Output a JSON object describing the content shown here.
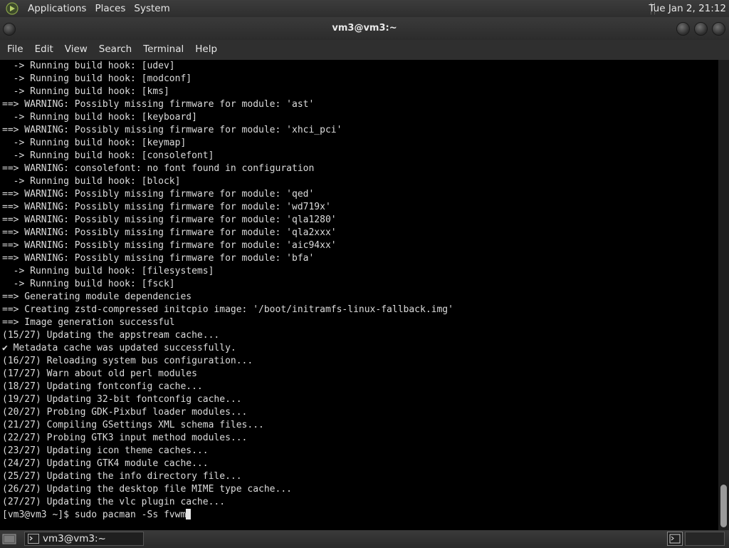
{
  "top_panel": {
    "menus": [
      "Applications",
      "Places",
      "System"
    ],
    "clock": "Tue Jan  2, 21:12",
    "logo_icon": "arch-linux-logo"
  },
  "window": {
    "title": "vm3@vm3:~",
    "menu": [
      "File",
      "Edit",
      "View",
      "Search",
      "Terminal",
      "Help"
    ]
  },
  "terminal": {
    "lines": [
      "  -> Running build hook: [udev]",
      "  -> Running build hook: [modconf]",
      "  -> Running build hook: [kms]",
      "==> WARNING: Possibly missing firmware for module: 'ast'",
      "  -> Running build hook: [keyboard]",
      "==> WARNING: Possibly missing firmware for module: 'xhci_pci'",
      "  -> Running build hook: [keymap]",
      "  -> Running build hook: [consolefont]",
      "==> WARNING: consolefont: no font found in configuration",
      "  -> Running build hook: [block]",
      "==> WARNING: Possibly missing firmware for module: 'qed'",
      "==> WARNING: Possibly missing firmware for module: 'wd719x'",
      "==> WARNING: Possibly missing firmware for module: 'qla1280'",
      "==> WARNING: Possibly missing firmware for module: 'qla2xxx'",
      "==> WARNING: Possibly missing firmware for module: 'aic94xx'",
      "==> WARNING: Possibly missing firmware for module: 'bfa'",
      "  -> Running build hook: [filesystems]",
      "  -> Running build hook: [fsck]",
      "==> Generating module dependencies",
      "==> Creating zstd-compressed initcpio image: '/boot/initramfs-linux-fallback.img'",
      "==> Image generation successful",
      "(15/27) Updating the appstream cache...",
      "✔ Metadata cache was updated successfully.",
      "(16/27) Reloading system bus configuration...",
      "(17/27) Warn about old perl modules",
      "(18/27) Updating fontconfig cache...",
      "(19/27) Updating 32-bit fontconfig cache...",
      "(20/27) Probing GDK-Pixbuf loader modules...",
      "(21/27) Compiling GSettings XML schema files...",
      "(22/27) Probing GTK3 input method modules...",
      "(23/27) Updating icon theme caches...",
      "(24/27) Updating GTK4 module cache...",
      "(25/27) Updating the info directory file...",
      "(26/27) Updating the desktop file MIME type cache...",
      "(27/27) Updating the vlc plugin cache..."
    ],
    "prompt": "[vm3@vm3 ~]$ ",
    "command": "sudo pacman -Ss fvwm"
  },
  "bottom_panel": {
    "task_label": "vm3@vm3:~",
    "task_icon": "terminal-icon",
    "show_desktop_icon": "show-desktop-icon"
  },
  "colors": {
    "terminal_bg": "#000000",
    "terminal_fg": "#dcdcdc",
    "panel_bg": "#2e2e2e"
  }
}
